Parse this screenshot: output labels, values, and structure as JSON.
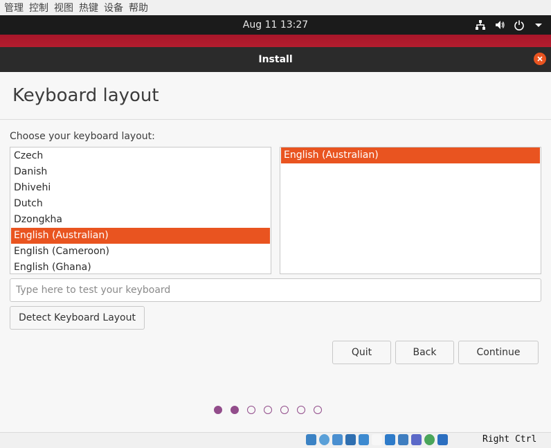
{
  "vbox_menu": {
    "items": [
      "管理",
      "控制",
      "视图",
      "热键",
      "设备",
      "帮助"
    ]
  },
  "topbar": {
    "clock": "Aug 11  13:27",
    "tray_icons": [
      "network-icon",
      "volume-icon",
      "power-icon",
      "dropdown-arrow-icon"
    ]
  },
  "window": {
    "title": "Install"
  },
  "page": {
    "title": "Keyboard layout",
    "prompt": "Choose your keyboard layout:"
  },
  "layouts": {
    "items": [
      "Czech",
      "Danish",
      "Dhivehi",
      "Dutch",
      "Dzongkha",
      "English (Australian)",
      "English (Cameroon)",
      "English (Ghana)"
    ],
    "selected": "English (Australian)"
  },
  "variants": {
    "items": [
      "English (Australian)"
    ],
    "selected": "English (Australian)"
  },
  "test_input": {
    "placeholder": "Type here to test your keyboard",
    "value": ""
  },
  "buttons": {
    "detect": "Detect Keyboard Layout",
    "quit": "Quit",
    "back": "Back",
    "continue": "Continue"
  },
  "progress": {
    "total_steps": 7,
    "current_step": 2
  },
  "vbox_status": {
    "host_key": "Right Ctrl"
  },
  "colors": {
    "accent": "#e95420",
    "progress": "#924d8b",
    "titlebar": "#2b2b2b"
  }
}
